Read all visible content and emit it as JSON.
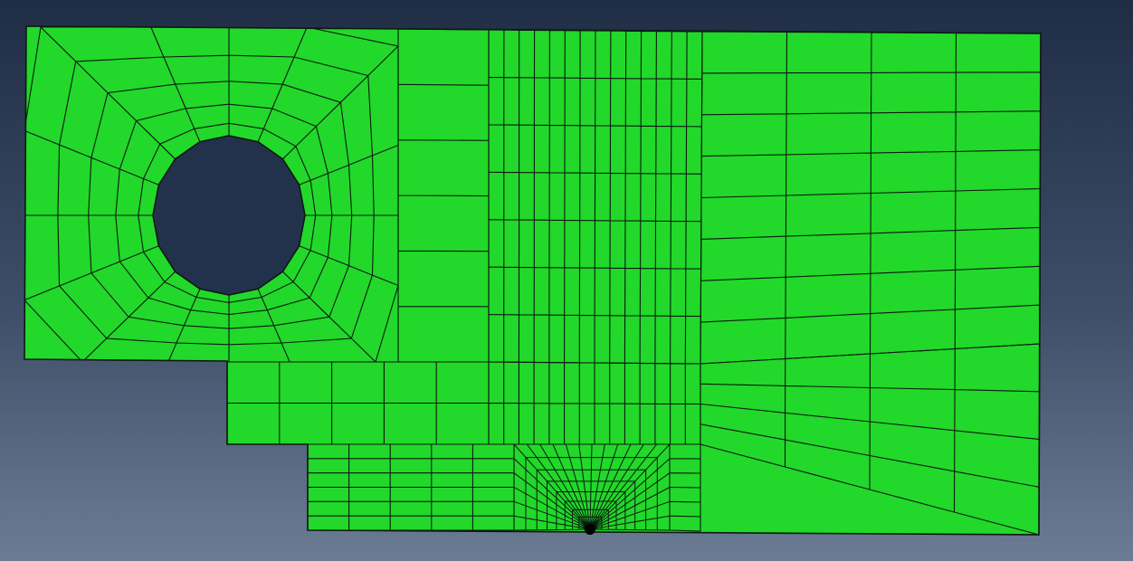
{
  "viewport": {
    "background_top": "#1f2d45",
    "background_bottom": "#6b7c94",
    "mesh_fill": "#22d82a",
    "mesh_line": "#0b1a10",
    "hole_fill": "#23324c",
    "icons": [
      "mesh-part",
      "hole",
      "crack-tip"
    ]
  }
}
